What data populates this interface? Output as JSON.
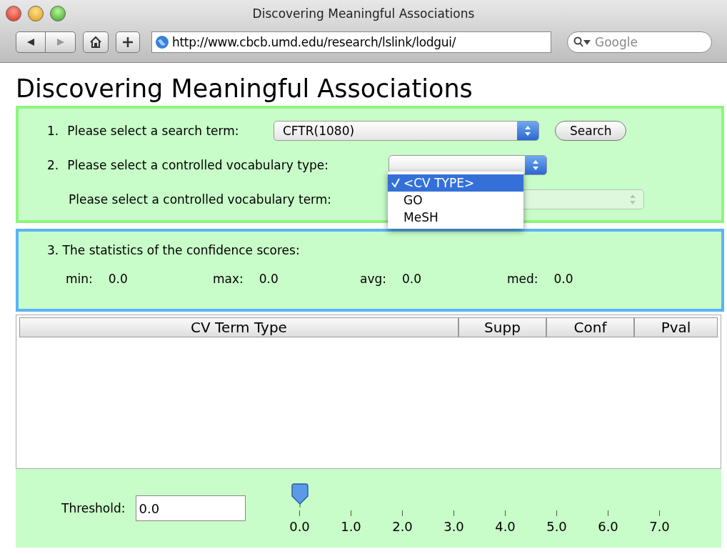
{
  "window": {
    "title": "Discovering Meaningful Associations"
  },
  "toolbar": {
    "url": "http://www.cbcb.umd.edu/research/lslink/lodgui/",
    "search": {
      "placeholder": "Google"
    }
  },
  "page": {
    "heading": "Discovering Meaningful Associations"
  },
  "step1": {
    "number": "1.",
    "label": "Please select a search term:",
    "select_value": "CFTR(1080)",
    "button": "Search"
  },
  "step2": {
    "number": "2.",
    "label": "Please select a controlled vocabulary type:",
    "menu": [
      {
        "label": "<CV TYPE>",
        "selected": true
      },
      {
        "label": "GO",
        "selected": false
      },
      {
        "label": "MeSH",
        "selected": false
      }
    ],
    "term_label": "Please select a controlled vocabulary term:",
    "term_select_disabled": true
  },
  "stats": {
    "title": "3. The statistics of the confidence scores:",
    "items": [
      {
        "label": "min:",
        "value": "0.0"
      },
      {
        "label": "max:",
        "value": "0.0"
      },
      {
        "label": "avg:",
        "value": "0.0"
      },
      {
        "label": "med:",
        "value": "0.0"
      }
    ]
  },
  "table": {
    "columns": [
      "CV Term Type",
      "Supp",
      "Conf",
      "Pval"
    ]
  },
  "threshold": {
    "label": "Threshold:",
    "value": "0.0",
    "slider": {
      "ticks": [
        "0.0",
        "1.0",
        "2.0",
        "3.0",
        "4.0",
        "5.0",
        "6.0",
        "7.0"
      ]
    }
  }
}
